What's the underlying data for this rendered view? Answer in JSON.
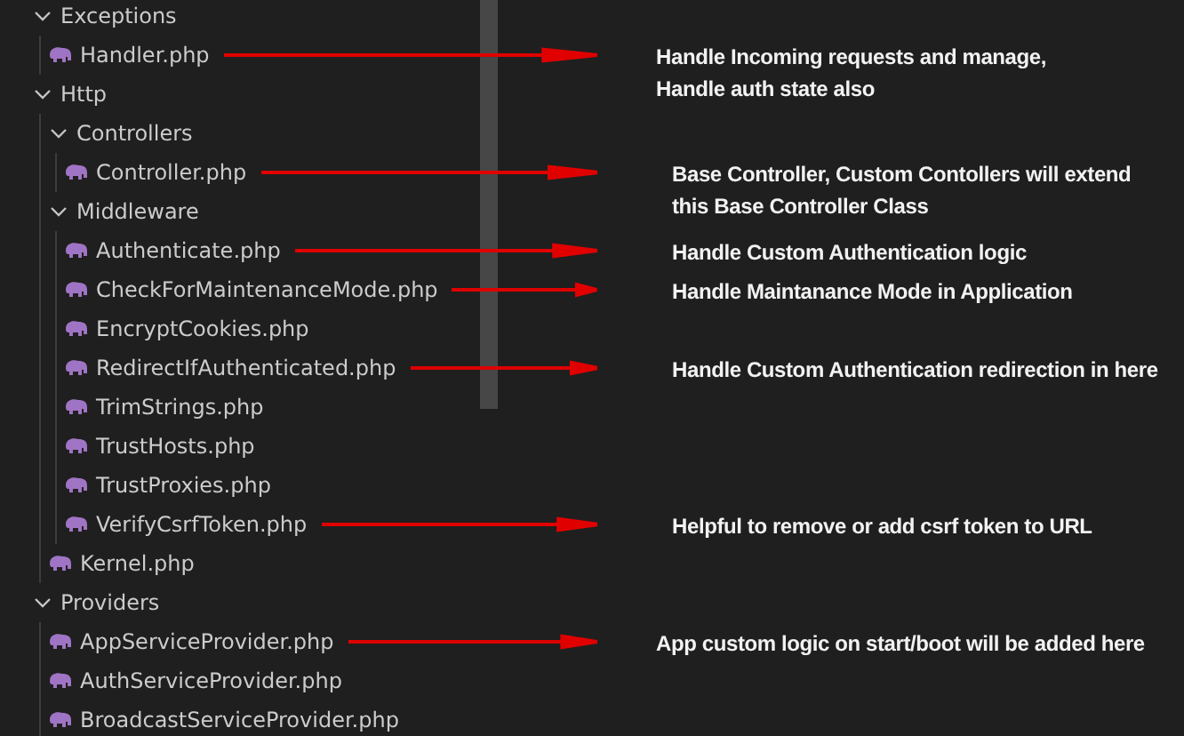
{
  "tree": [
    {
      "label": "Exceptions",
      "kind": "folder",
      "expanded": true,
      "children": [
        {
          "label": "Handler.php",
          "kind": "file",
          "note": [
            "Handle Incoming requests and manage,",
            "Handle auth state also"
          ]
        }
      ]
    },
    {
      "label": "Http",
      "kind": "folder",
      "expanded": true,
      "children": [
        {
          "label": "Controllers",
          "kind": "folder",
          "expanded": true,
          "children": [
            {
              "label": "Controller.php",
              "kind": "file",
              "note": [
                "Base Controller, Custom Contollers will extend",
                "this Base Controller Class"
              ]
            }
          ]
        },
        {
          "label": "Middleware",
          "kind": "folder",
          "expanded": true,
          "children": [
            {
              "label": "Authenticate.php",
              "kind": "file",
              "note": [
                "Handle Custom Authentication logic"
              ]
            },
            {
              "label": "CheckForMaintenanceMode.php",
              "kind": "file",
              "note": [
                "Handle Maintanance Mode in Application"
              ]
            },
            {
              "label": "EncryptCookies.php",
              "kind": "file"
            },
            {
              "label": "RedirectIfAuthenticated.php",
              "kind": "file",
              "note": [
                "Handle Custom Authentication redirection in here"
              ]
            },
            {
              "label": "TrimStrings.php",
              "kind": "file"
            },
            {
              "label": "TrustHosts.php",
              "kind": "file"
            },
            {
              "label": "TrustProxies.php",
              "kind": "file"
            },
            {
              "label": "VerifyCsrfToken.php",
              "kind": "file",
              "note": [
                "Helpful to remove or add csrf token to URL"
              ]
            }
          ]
        },
        {
          "label": "Kernel.php",
          "kind": "file"
        }
      ]
    },
    {
      "label": "Providers",
      "kind": "folder",
      "expanded": true,
      "children": [
        {
          "label": "AppServiceProvider.php",
          "kind": "file",
          "note": [
            "App custom logic on start/boot will be added here"
          ]
        },
        {
          "label": "AuthServiceProvider.php",
          "kind": "file"
        },
        {
          "label": "BroadcastServiceProvider.php",
          "kind": "file"
        }
      ]
    }
  ]
}
